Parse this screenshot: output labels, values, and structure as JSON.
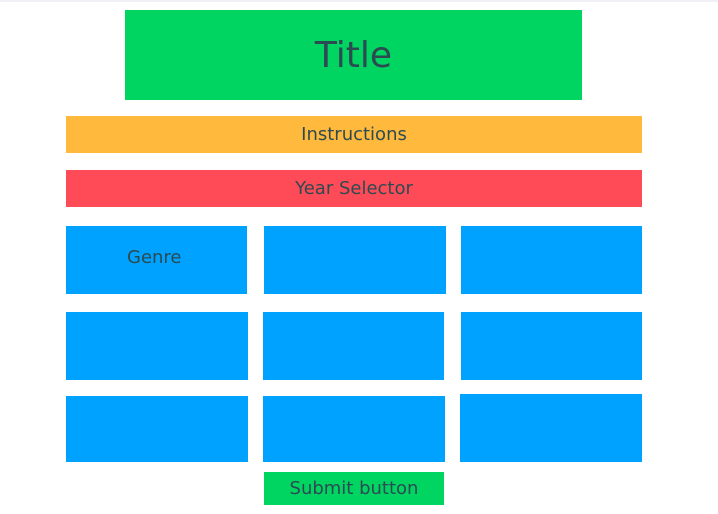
{
  "title": "Title",
  "instructions": "Instructions",
  "year_selector": "Year Selector",
  "genres": [
    {
      "label": "Genre"
    },
    {
      "label": ""
    },
    {
      "label": ""
    },
    {
      "label": ""
    },
    {
      "label": ""
    },
    {
      "label": ""
    },
    {
      "label": ""
    },
    {
      "label": ""
    },
    {
      "label": ""
    }
  ],
  "submit": "Submit button",
  "colors": {
    "title": "#00d562",
    "instructions": "#ffb93c",
    "year_selector": "#ff4b57",
    "genre": "#00a2ff",
    "submit": "#00d562",
    "text": "#2c4a52"
  }
}
